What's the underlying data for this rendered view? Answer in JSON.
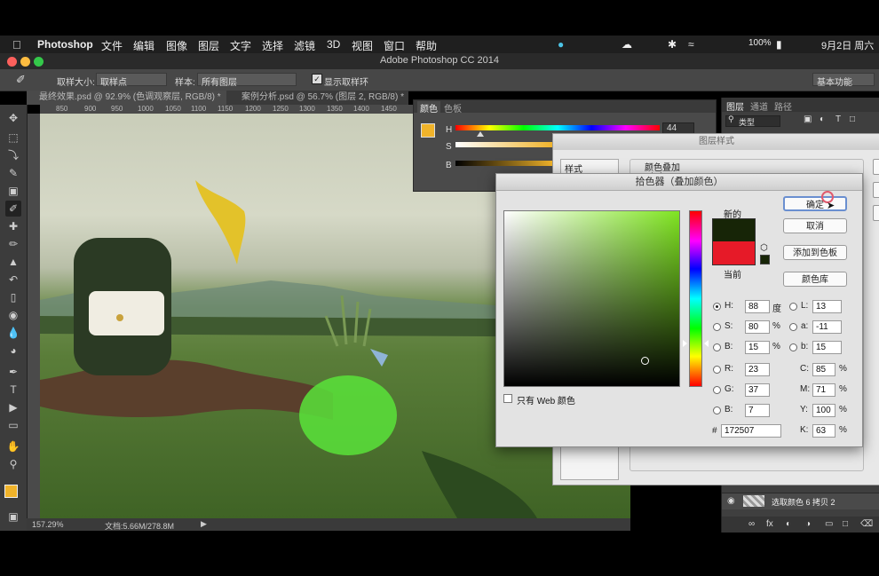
{
  "menubar": {
    "items": [
      "Photoshop",
      "文件",
      "编辑",
      "图像",
      "图层",
      "文字",
      "选择",
      "滤镜",
      "3D",
      "视图",
      "窗口",
      "帮助"
    ],
    "battery": "100%",
    "date": "9月2日 周六"
  },
  "window": {
    "title": "Adobe Photoshop CC 2014"
  },
  "options_bar": {
    "sample_size_label": "取样大小:",
    "sample_size_value": "取样点",
    "sample_label": "样本:",
    "sample_value": "所有图层",
    "show_ring_label": "显示取样环",
    "workspace": "基本功能"
  },
  "tabs": [
    {
      "label": "最终效果.psd @ 92.9% (色调观察层, RGB/8) *"
    },
    {
      "label": "案例分析.psd @ 56.7% (图层 2, RGB/8) *"
    }
  ],
  "ruler_ticks": [
    "850",
    "900",
    "950",
    "1000",
    "1050",
    "1100",
    "1150",
    "1200",
    "1250",
    "1300",
    "1350",
    "1400",
    "1450"
  ],
  "status": {
    "zoom": "157.29%",
    "doc": "文档:5.66M/278.8M"
  },
  "color_panel": {
    "tabs": [
      "颜色",
      "色板"
    ],
    "h_label": "H",
    "s_label": "S",
    "b_label": "B",
    "h_value": "44",
    "h_fraction": 0.12,
    "accent": "#f0b32a"
  },
  "layers_panel": {
    "tabs": [
      "图层",
      "通道",
      "路径"
    ],
    "filter_label": "类型",
    "layer_name": "选取颜色 6 拷贝 2"
  },
  "layer_style": {
    "title": "图层样式",
    "sidebar_label": "样式",
    "section_title": "颜色叠加",
    "section_sub": "颜色"
  },
  "picker": {
    "title": "拾色器（叠加颜色）",
    "new_label": "新的",
    "current_label": "当前",
    "new_color": "#172507",
    "current_color": "#e61a28",
    "buttons": {
      "ok": "确定",
      "cancel": "取消",
      "add_swatch": "添加到色板",
      "library": "颜色库"
    },
    "web_only": "只有 Web 颜色",
    "H": "88",
    "S": "80",
    "B": "15",
    "R": "23",
    "G": "37",
    "Bv": "7",
    "L": "13",
    "a": "-11",
    "b": "15",
    "C": "85",
    "M": "71",
    "Y": "100",
    "K": "63",
    "hex": "172507",
    "units": {
      "deg": "度",
      "pct": "%"
    }
  },
  "watermark": "虎课网"
}
